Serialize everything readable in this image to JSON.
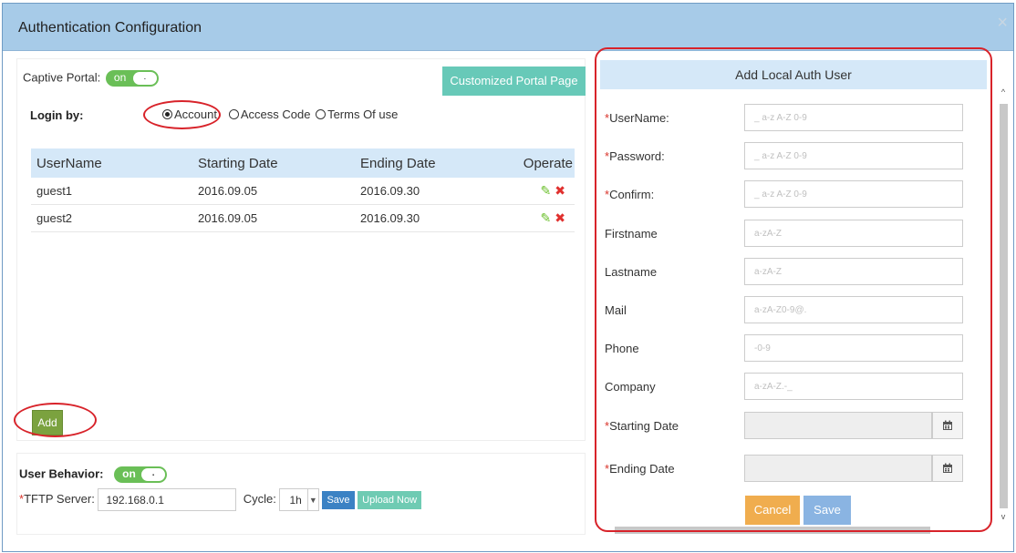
{
  "dialog": {
    "title": "Authentication Configuration",
    "close_glyph": "×"
  },
  "captive_portal": {
    "label": "Captive Portal:",
    "toggle_text": "on",
    "knob_text": "."
  },
  "customized_portal_button": "Customized Portal Page",
  "login_by": {
    "label": "Login by:",
    "options": [
      "Account",
      "Access Code",
      "Terms Of use"
    ],
    "selected": "Account"
  },
  "users_table": {
    "headers": [
      "UserName",
      "Starting Date",
      "Ending Date",
      "Operate"
    ],
    "rows": [
      {
        "username": "guest1",
        "start": "2016.09.05",
        "end": "2016.09.30"
      },
      {
        "username": "guest2",
        "start": "2016.09.05",
        "end": "2016.09.30"
      }
    ]
  },
  "add_button": "Add",
  "user_behavior": {
    "label": "User Behavior:",
    "toggle_text": "on",
    "knob_text": ".",
    "tftp_label": "TFTP Server:",
    "tftp_value": "192.168.0.1",
    "cycle_label": "Cycle:",
    "cycle_value": "1h",
    "save_label": "Save",
    "upload_label": "Upload Now"
  },
  "add_user_form": {
    "header": "Add Local Auth User",
    "fields": [
      {
        "label": "UserName:",
        "required": true,
        "placeholder": "_ a-z A-Z 0-9"
      },
      {
        "label": "Password:",
        "required": true,
        "placeholder": "_ a-z A-Z 0-9"
      },
      {
        "label": "Confirm:",
        "required": true,
        "placeholder": "_ a-z A-Z 0-9"
      },
      {
        "label": "Firstname",
        "required": false,
        "placeholder": "a-zA-Z"
      },
      {
        "label": "Lastname",
        "required": false,
        "placeholder": "a-zA-Z"
      },
      {
        "label": "Mail",
        "required": false,
        "placeholder": "a-zA-Z0-9@."
      },
      {
        "label": "Phone",
        "required": false,
        "placeholder": "-0-9"
      },
      {
        "label": "Company",
        "required": false,
        "placeholder": "a-zA-Z.-_"
      }
    ],
    "starting_date_label": "Starting Date",
    "ending_date_label": "Ending Date",
    "cancel_label": "Cancel",
    "save_label": "Save"
  },
  "colors": {
    "title_bar": "#a7cbe8",
    "table_header": "#d5e8f8",
    "toggle_on": "#6abf57",
    "portal_button": "#67c9b8",
    "add_button": "#7ba23f",
    "cancel_button": "#f0ad4e",
    "save_button": "#8ab4e2",
    "annotation": "#d8232a",
    "required_mark": "#d9342b"
  },
  "icons": [
    "close-icon",
    "edit-pencil-icon",
    "delete-x-icon",
    "calendar-icon",
    "chevron-down-icon",
    "scroll-up-arrow-icon",
    "scroll-down-arrow-icon"
  ]
}
